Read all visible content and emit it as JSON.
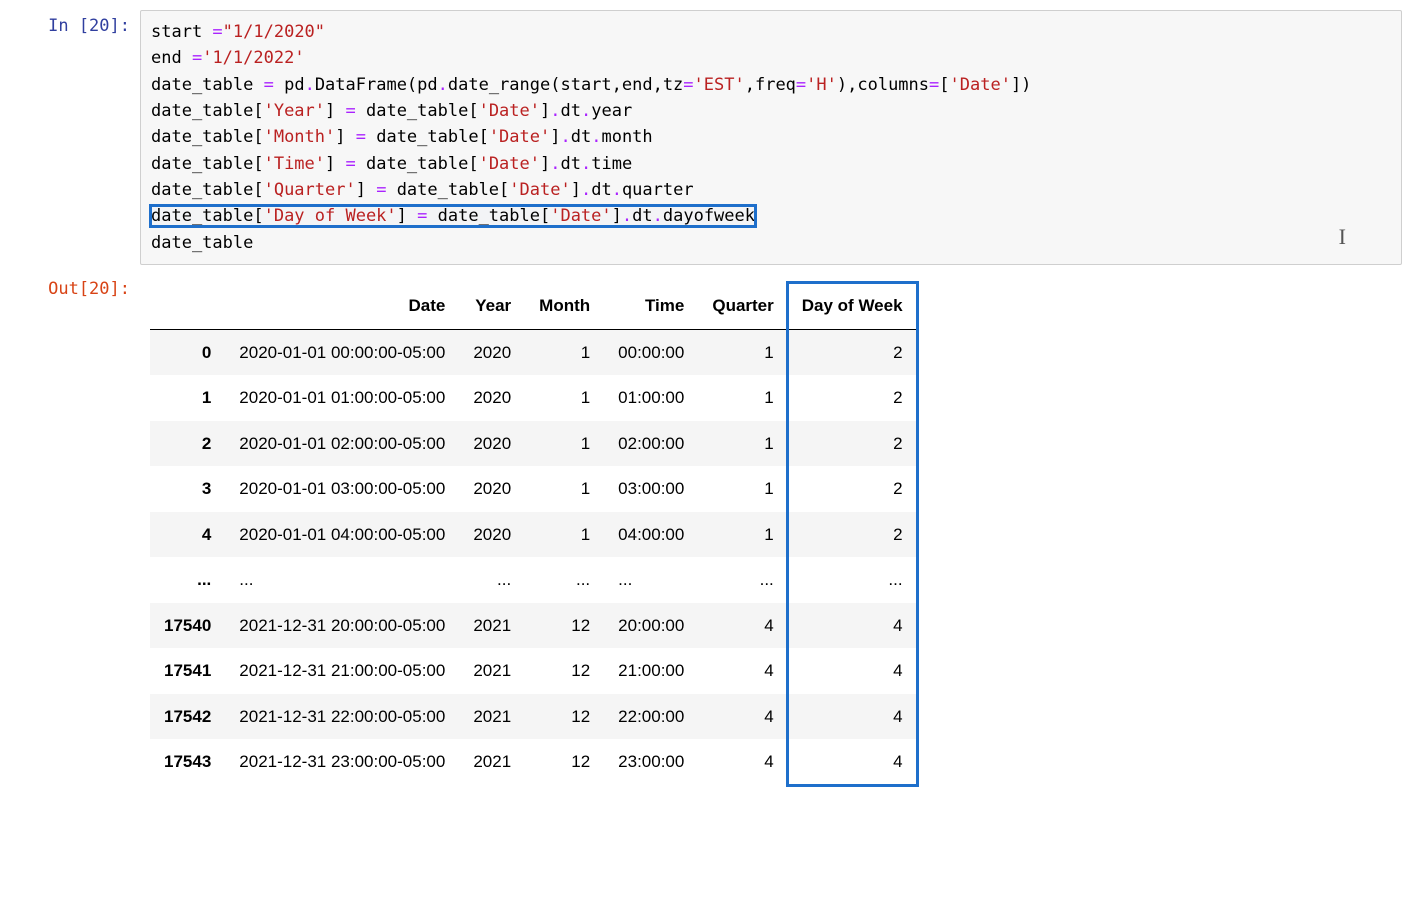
{
  "in_prompt": "In [20]:",
  "out_prompt": "Out[20]:",
  "code": {
    "l1a": "start ",
    "l1op": "=",
    "l1s": "\"1/1/2020\"",
    "l2a": "end ",
    "l2op": "=",
    "l2s": "'1/1/2022'",
    "l3a": "date_table ",
    "l3op": "=",
    "l3b": " pd",
    "l3op2": ".",
    "l3c": "DataFrame(pd",
    "l3op3": ".",
    "l3d": "date_range(start,end,tz",
    "l3op4": "=",
    "l3s1": "'EST'",
    "l3e": ",freq",
    "l3op5": "=",
    "l3s2": "'H'",
    "l3f": "),columns",
    "l3op6": "=",
    "l3g": "[",
    "l3s3": "'Date'",
    "l3h": "])",
    "l4a": "date_table[",
    "l4s1": "'Year'",
    "l4b": "] ",
    "l4op": "=",
    "l4c": " date_table[",
    "l4s2": "'Date'",
    "l4d": "]",
    "l4op2": ".",
    "l4e": "dt",
    "l4op3": ".",
    "l4f": "year",
    "l5a": "date_table[",
    "l5s1": "'Month'",
    "l5b": "] ",
    "l5op": "=",
    "l5c": " date_table[",
    "l5s2": "'Date'",
    "l5d": "]",
    "l5op2": ".",
    "l5e": "dt",
    "l5op3": ".",
    "l5f": "month",
    "l6a": "date_table[",
    "l6s1": "'Time'",
    "l6b": "] ",
    "l6op": "=",
    "l6c": " date_table[",
    "l6s2": "'Date'",
    "l6d": "]",
    "l6op2": ".",
    "l6e": "dt",
    "l6op3": ".",
    "l6f": "time",
    "l7a": "date_table[",
    "l7s1": "'Quarter'",
    "l7b": "] ",
    "l7op": "=",
    "l7c": " date_table[",
    "l7s2": "'Date'",
    "l7d": "]",
    "l7op2": ".",
    "l7e": "dt",
    "l7op3": ".",
    "l7f": "quarter",
    "l8a": "date_table[",
    "l8s1": "'Day of Week'",
    "l8b": "] ",
    "l8op": "=",
    "l8c": " date_table[",
    "l8s2": "'Date'",
    "l8d": "]",
    "l8op2": ".",
    "l8e": "dt",
    "l8op3": ".",
    "l8f": "dayofweek",
    "l9": "date_table"
  },
  "table": {
    "headers": [
      "",
      "Date",
      "Year",
      "Month",
      "Time",
      "Quarter",
      "Day of Week"
    ],
    "rows": [
      {
        "idx": "0",
        "date": "2020-01-01 00:00:00-05:00",
        "year": "2020",
        "month": "1",
        "time": "00:00:00",
        "quarter": "1",
        "dow": "2"
      },
      {
        "idx": "1",
        "date": "2020-01-01 01:00:00-05:00",
        "year": "2020",
        "month": "1",
        "time": "01:00:00",
        "quarter": "1",
        "dow": "2"
      },
      {
        "idx": "2",
        "date": "2020-01-01 02:00:00-05:00",
        "year": "2020",
        "month": "1",
        "time": "02:00:00",
        "quarter": "1",
        "dow": "2"
      },
      {
        "idx": "3",
        "date": "2020-01-01 03:00:00-05:00",
        "year": "2020",
        "month": "1",
        "time": "03:00:00",
        "quarter": "1",
        "dow": "2"
      },
      {
        "idx": "4",
        "date": "2020-01-01 04:00:00-05:00",
        "year": "2020",
        "month": "1",
        "time": "04:00:00",
        "quarter": "1",
        "dow": "2"
      },
      {
        "idx": "...",
        "date": "...",
        "year": "...",
        "month": "...",
        "time": "...",
        "quarter": "...",
        "dow": "..."
      },
      {
        "idx": "17540",
        "date": "2021-12-31 20:00:00-05:00",
        "year": "2021",
        "month": "12",
        "time": "20:00:00",
        "quarter": "4",
        "dow": "4"
      },
      {
        "idx": "17541",
        "date": "2021-12-31 21:00:00-05:00",
        "year": "2021",
        "month": "12",
        "time": "21:00:00",
        "quarter": "4",
        "dow": "4"
      },
      {
        "idx": "17542",
        "date": "2021-12-31 22:00:00-05:00",
        "year": "2021",
        "month": "12",
        "time": "22:00:00",
        "quarter": "4",
        "dow": "4"
      },
      {
        "idx": "17543",
        "date": "2021-12-31 23:00:00-05:00",
        "year": "2021",
        "month": "12",
        "time": "23:00:00",
        "quarter": "4",
        "dow": "4"
      }
    ]
  },
  "cursor_glyph": "I"
}
